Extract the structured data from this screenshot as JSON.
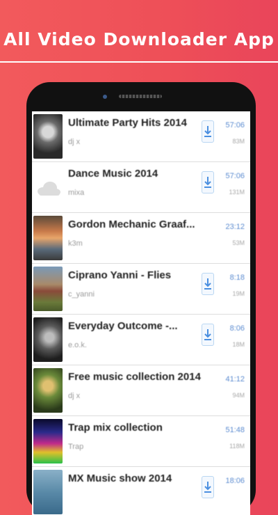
{
  "banner": {
    "title": "All Video Downloader App"
  },
  "list": [
    {
      "title": "Ultimate Party Hits 2014",
      "subtitle": "dj x",
      "duration": "57:06",
      "size": "83M",
      "download": true,
      "thumb": "bw-portrait"
    },
    {
      "title": "Dance Music 2014",
      "subtitle": "mixa",
      "duration": "57:06",
      "size": "131M",
      "download": true,
      "thumb": "cloud"
    },
    {
      "title": "Gordon Mechanic Graaf...",
      "subtitle": "k3m",
      "duration": "23:12",
      "size": "53M",
      "download": false,
      "thumb": "sunset"
    },
    {
      "title": "Ciprano Yanni - Flies",
      "subtitle": "c_yanni",
      "duration": "8:18",
      "size": "19M",
      "download": true,
      "thumb": "field"
    },
    {
      "title": "Everyday Outcome -...",
      "subtitle": "e.o.k.",
      "duration": "8:06",
      "size": "18M",
      "download": true,
      "thumb": "bw-face"
    },
    {
      "title": "Free music collection 2014",
      "subtitle": "dj x",
      "duration": "41:12",
      "size": "94M",
      "download": false,
      "thumb": "figure"
    },
    {
      "title": "Trap mix collection",
      "subtitle": "Trap",
      "duration": "51:48",
      "size": "118M",
      "download": false,
      "thumb": "neon"
    },
    {
      "title": "MX Music show 2014",
      "subtitle": "",
      "duration": "18:06",
      "size": "",
      "download": true,
      "thumb": "sea"
    }
  ]
}
